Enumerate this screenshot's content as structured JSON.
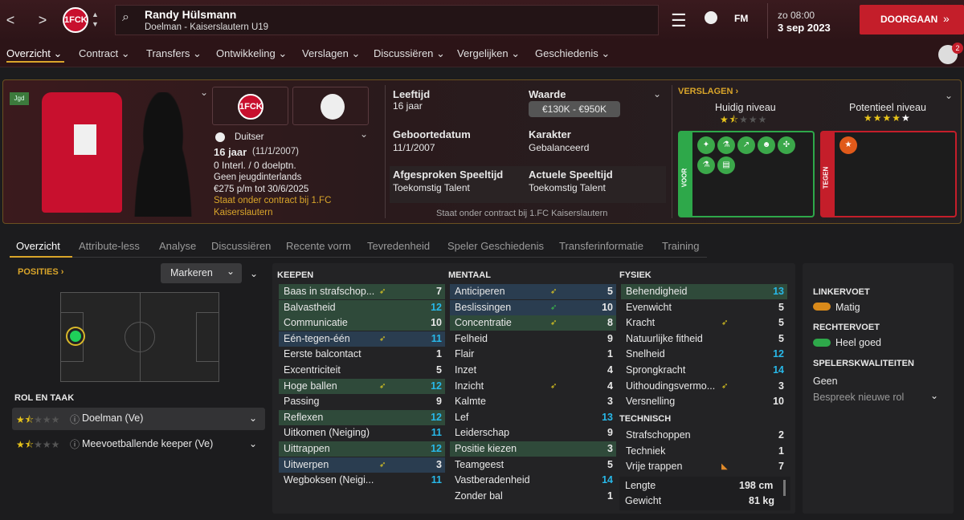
{
  "topbar": {
    "back": "<",
    "forward": ">",
    "club_badge": "1FCK",
    "player_name": "Randy Hülsmann",
    "player_sub": "Doelman - Kaiserslautern U19",
    "fm": "FM",
    "date_day": "zo 08:00",
    "date_full": "3 sep 2023",
    "continue": "DOORGAAN",
    "notif_count": "2"
  },
  "menu": [
    "Overzicht",
    "Contract",
    "Transfers",
    "Ontwikkeling",
    "Verslagen",
    "Discussiëren",
    "Vergelijken",
    "Geschiedenis"
  ],
  "header": {
    "tag": "Jgd",
    "nationality": "Duitser",
    "age_line": "16 jaar",
    "dob_paren": "(11/1/2007)",
    "intl": "0 Interl. / 0 doelptn.",
    "youth_intl": "Geen jeugdinterlands",
    "wage": "€275 p/m tot 30/6/2025",
    "contract_note": "Staat onder contract bij 1.FC Kaiserslautern",
    "age_label": "Leeftijd",
    "age_value": "16 jaar",
    "value_label": "Waarde",
    "value_value": "€130K - €950K",
    "dob_label": "Geboortedatum",
    "dob_value": "11/1/2007",
    "char_label": "Karakter",
    "char_value": "Gebalanceerd",
    "agreed_label": "Afgesproken Speeltijd",
    "agreed_value": "Toekomstig Talent",
    "actual_label": "Actuele Speeltijd",
    "actual_value": "Toekomstig Talent",
    "footer_note": "Staat onder contract bij 1.FC Kaiserslautern",
    "reports": "VERSLAGEN",
    "current_level": "Huidig niveau",
    "potential_level": "Potentieel niveau",
    "current_stars": 1.5,
    "potential_stars": 4.5,
    "voor": "VOOR",
    "tegen": "TEGEN"
  },
  "tabs": [
    "Overzicht",
    "Attribute-less",
    "Analyse",
    "Discussiëren",
    "Recente vorm",
    "Tevredenheid",
    "Speler Geschiedenis",
    "Transferinformatie",
    "Training"
  ],
  "positions": {
    "title": "POSITIES",
    "mark_btn": "Markeren",
    "role_title": "ROL EN TAAK",
    "roles": [
      {
        "name": "Doelman (Ve)",
        "stars": 1.5
      },
      {
        "name": "Meevoetballende keeper (Ve)",
        "stars": 1.5
      }
    ]
  },
  "keepen": {
    "title": "KEEPEN",
    "rows": [
      {
        "name": "Baas in strafschop...",
        "value": "7",
        "hl": "g",
        "arrow": "up"
      },
      {
        "name": "Balvastheid",
        "value": "12",
        "hl": "g",
        "blue": true
      },
      {
        "name": "Communicatie",
        "value": "10",
        "hl": "g"
      },
      {
        "name": "Eén-tegen-één",
        "value": "11",
        "hl": "b",
        "arrow": "up",
        "blue": true
      },
      {
        "name": "Eerste balcontact",
        "value": "1"
      },
      {
        "name": "Excentriciteit",
        "value": "5"
      },
      {
        "name": "Hoge ballen",
        "value": "12",
        "hl": "g",
        "arrow": "up",
        "blue": true
      },
      {
        "name": "Passing",
        "value": "9"
      },
      {
        "name": "Reflexen",
        "value": "12",
        "hl": "g",
        "blue": true
      },
      {
        "name": "Uitkomen (Neiging)",
        "value": "11",
        "blue": true
      },
      {
        "name": "Uittrappen",
        "value": "12",
        "hl": "g",
        "blue": true
      },
      {
        "name": "Uitwerpen",
        "value": "3",
        "hl": "b",
        "arrow": "up"
      },
      {
        "name": "Wegboksen (Neigi...",
        "value": "11",
        "blue": true
      }
    ]
  },
  "mentaal": {
    "title": "MENTAAL",
    "rows": [
      {
        "name": "Anticiperen",
        "value": "5",
        "hl": "b",
        "arrow": "up"
      },
      {
        "name": "Beslissingen",
        "value": "10",
        "hl": "b",
        "arrow": "green"
      },
      {
        "name": "Concentratie",
        "value": "8",
        "hl": "g",
        "arrow": "up"
      },
      {
        "name": "Felheid",
        "value": "9"
      },
      {
        "name": "Flair",
        "value": "1"
      },
      {
        "name": "Inzet",
        "value": "4"
      },
      {
        "name": "Inzicht",
        "value": "4",
        "arrow": "up"
      },
      {
        "name": "Kalmte",
        "value": "3"
      },
      {
        "name": "Lef",
        "value": "13",
        "blue": true
      },
      {
        "name": "Leiderschap",
        "value": "9"
      },
      {
        "name": "Positie kiezen",
        "value": "3",
        "hl": "g"
      },
      {
        "name": "Teamgeest",
        "value": "5"
      },
      {
        "name": "Vastberadenheid",
        "value": "14",
        "blue": true
      },
      {
        "name": "Zonder bal",
        "value": "1"
      }
    ]
  },
  "fysiek": {
    "title": "FYSIEK",
    "rows": [
      {
        "name": "Behendigheid",
        "value": "13",
        "hl": "g",
        "blue": true
      },
      {
        "name": "Evenwicht",
        "value": "5"
      },
      {
        "name": "Kracht",
        "value": "5",
        "arrow": "up"
      },
      {
        "name": "Natuurlijke fitheid",
        "value": "5"
      },
      {
        "name": "Snelheid",
        "value": "12",
        "blue": true
      },
      {
        "name": "Sprongkracht",
        "value": "14",
        "blue": true
      },
      {
        "name": "Uithoudingsvermo...",
        "value": "3",
        "arrow": "up"
      },
      {
        "name": "Versnelling",
        "value": "10"
      }
    ]
  },
  "technisch": {
    "title": "TECHNISCH",
    "rows": [
      {
        "name": "Strafschoppen",
        "value": "2"
      },
      {
        "name": "Techniek",
        "value": "1"
      },
      {
        "name": "Vrije trappen",
        "value": "7",
        "arrow": "orange"
      }
    ]
  },
  "body": {
    "height_label": "Lengte",
    "height_value": "198 cm",
    "weight_label": "Gewicht",
    "weight_value": "81 kg"
  },
  "side": {
    "left_foot_title": "LINKERVOET",
    "left_foot": "Matig",
    "right_foot_title": "RECHTERVOET",
    "right_foot": "Heel goed",
    "traits_title": "SPELERSKWALITEITEN",
    "traits": "Geen",
    "discuss_traits": "Bespreek nieuwe rol"
  }
}
